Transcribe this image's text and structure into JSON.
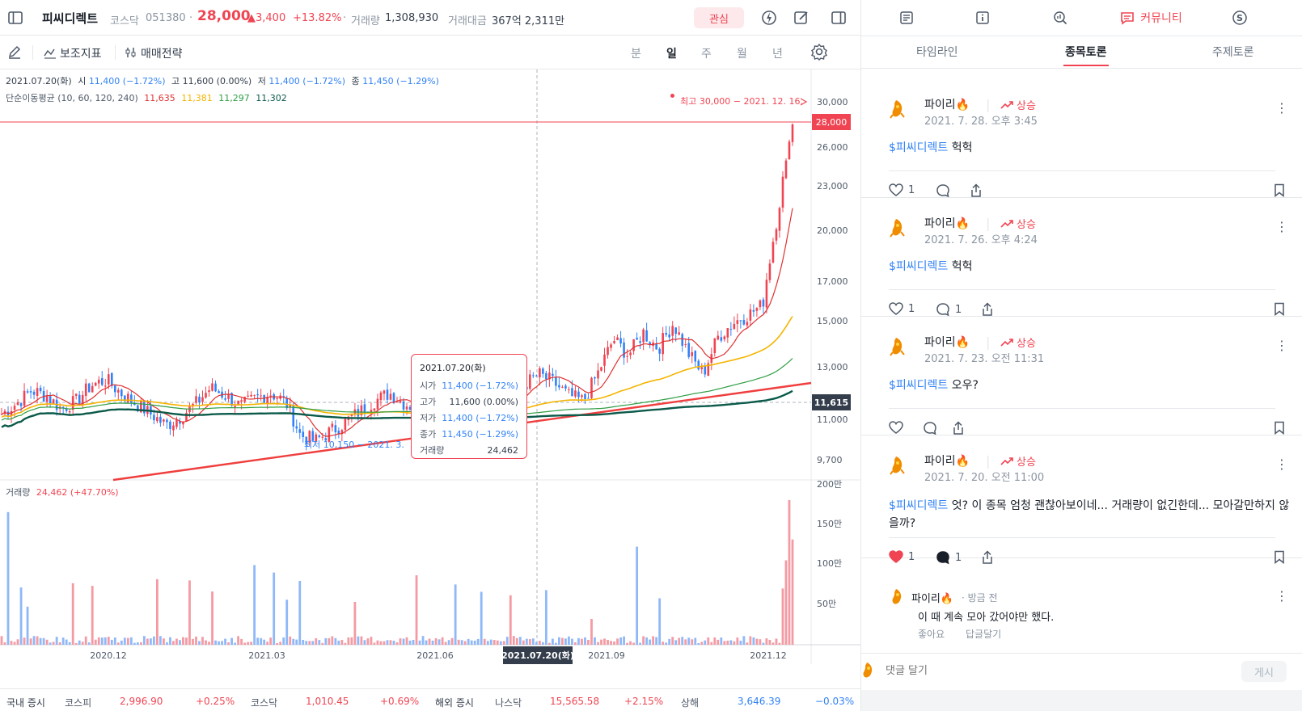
{
  "header": {
    "stock_name": "피씨디렉트",
    "market": "코스닥",
    "code": "051380",
    "price": "28,000",
    "change": "▲3,400",
    "change_pct": "+13.82%",
    "volume_label": "거래량",
    "volume": "1,308,930",
    "amount_label": "거래대금",
    "amount": "367억 2,311만",
    "watch_label": "관심"
  },
  "toolbar": {
    "indicator_label": "보조지표",
    "strategy_label": "매매전략",
    "periods": [
      "분",
      "일",
      "주",
      "월",
      "년"
    ],
    "active_period": "일"
  },
  "chart_info": {
    "date": "2021.07.20(화)",
    "open_label": "시",
    "open": "11,400 (−1.72%)",
    "high_label": "고",
    "high": "11,600 (0.00%)",
    "low_label": "저",
    "low": "11,400 (−1.72%)",
    "close_label": "종",
    "close": "11,450 (−1.29%)",
    "ma_label": "단순이동평균 (10, 60, 120, 240)",
    "ma10": "11,635",
    "ma60": "11,381",
    "ma120": "11,297",
    "ma240": "11,302",
    "max_note": "최고 30,000 − 2021. 12. 16.",
    "min_note": "최저 10,150 − 2021. 3.",
    "price_tag": "28,000",
    "cross_tag": "11,615",
    "volume_label": "거래량",
    "volume_value": "24,462 (+47.70%)",
    "cross_date": "2021.07.20(화)"
  },
  "tooltip": {
    "date": "2021.07.20(화)",
    "rows": [
      {
        "label": "시가",
        "value": "11,400 (−1.72%)"
      },
      {
        "label": "고가",
        "value": "11,600 (0.00%)"
      },
      {
        "label": "저가",
        "value": "11,400 (−1.72%)"
      },
      {
        "label": "종가",
        "value": "11,450 (−1.29%)"
      },
      {
        "label": "거래량",
        "value": "24,462"
      }
    ]
  },
  "chart_data": {
    "type": "line",
    "price_axis_ticks": [
      "30,000",
      "26,000",
      "23,000",
      "20,000",
      "17,000",
      "15,000",
      "13,000",
      "11,000",
      "9,700"
    ],
    "volume_axis_ticks": [
      "200만",
      "150만",
      "100만",
      "50만"
    ],
    "x_tick_labels": [
      "2020.12",
      "2021.03",
      "2021.06",
      "2021.09",
      "2021.12"
    ],
    "series": [
      {
        "values": [
          11200,
          11600,
          12100,
          11900,
          11400,
          11700,
          12300,
          12500,
          12000,
          11600,
          11200,
          10800,
          11100,
          11600,
          12200,
          11900,
          11500,
          11800,
          12000,
          11700,
          10500,
          10300,
          10600,
          10900,
          11300,
          11700,
          12000,
          11600,
          11400,
          11300,
          11800,
          12100,
          11600,
          11500,
          11800,
          12300,
          12700,
          12400,
          11900,
          11700,
          12800,
          14200,
          13500,
          14500,
          13800,
          14900,
          13600,
          12700,
          14300,
          14900,
          15300,
          15800,
          21000,
          28000
        ]
      }
    ]
  },
  "ticker": {
    "domestic_label": "국내 증시",
    "kospi_label": "코스피",
    "kospi": "2,996.90",
    "kospi_chg": "+0.25%",
    "kosdaq_label": "코스닥",
    "kosdaq": "1,010.45",
    "kosdaq_chg": "+0.69%",
    "overseas_label": "해외 증시",
    "nasdaq_label": "나스닥",
    "nasdaq": "15,565.58",
    "nasdaq_chg": "+2.15%",
    "shanghai_label": "상해",
    "shanghai": "3,646.39",
    "shanghai_chg": "−0.03%"
  },
  "right_panel": {
    "community_label": "커뮤니티",
    "tabs": [
      "타임라인",
      "종목토론",
      "주제토론"
    ],
    "active_tab": "종목토론",
    "posts": [
      {
        "user": "파이리🔥",
        "badge": "상승",
        "date": "2021. 7. 28. 오후 3:45",
        "tag": "$피씨디렉트",
        "text": " 헉헉",
        "likes": "1",
        "comments": ""
      },
      {
        "user": "파이리🔥",
        "badge": "상승",
        "date": "2021. 7. 26. 오후 4:24",
        "tag": "$피씨디렉트",
        "text": " 헉헉",
        "likes": "1",
        "comments": "1"
      },
      {
        "user": "파이리🔥",
        "badge": "상승",
        "date": "2021. 7. 23. 오전 11:31",
        "tag": "$피씨디렉트",
        "text": " 오우?",
        "likes": "",
        "comments": ""
      },
      {
        "user": "파이리🔥",
        "badge": "상승",
        "date": "2021. 7. 20. 오전 11:00",
        "tag": "$피씨디렉트",
        "text": " 엇? 이 종목 엄청 괜찮아보이네... 거래량이 없긴한데... 모아갈만하지 않을까?",
        "likes": "1",
        "comments": "1"
      }
    ],
    "reply": {
      "user": "파이리🔥",
      "time": "· 방금 전",
      "text": "이  때 계속 모아 갔어야만 했다.",
      "like_label": "좋아요",
      "reply_label": "답글달기"
    },
    "comment_placeholder": "댓글 달기",
    "post_button": "게시"
  },
  "colors": {
    "up": "#f04452",
    "down": "#3182f6",
    "ma10": "#e03131",
    "ma60": "#f5b400",
    "ma120": "#2f9e44",
    "ma240": "#0b5a4a"
  }
}
